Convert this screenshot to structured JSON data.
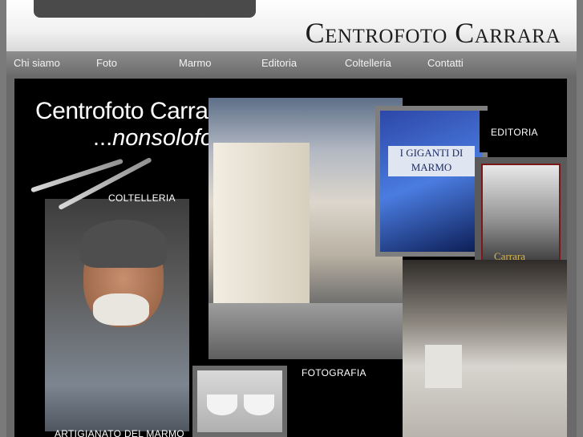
{
  "header": {
    "title": "Centrofoto Carrara"
  },
  "nav": {
    "items": [
      {
        "label": "Chi siamo"
      },
      {
        "label": "Foto"
      },
      {
        "label": "Marmo"
      },
      {
        "label": "Editoria"
      },
      {
        "label": "Coltelleria"
      },
      {
        "label": "Contatti"
      }
    ]
  },
  "hero": {
    "brand": "Centrofoto Carrara",
    "tagline_prefix": "...",
    "tagline": "nonsolofoto"
  },
  "sections": {
    "coltelleria": "COLTELLERIA",
    "editoria": "EDITORIA",
    "fotografia": "FOTOGRAFIA",
    "artigianato": "ARTIGIANATO DEL MARMO"
  },
  "book": {
    "cover_title": "I GIGANTI DI MARMO"
  },
  "carrara_book": {
    "cover_title": "Carrara"
  }
}
